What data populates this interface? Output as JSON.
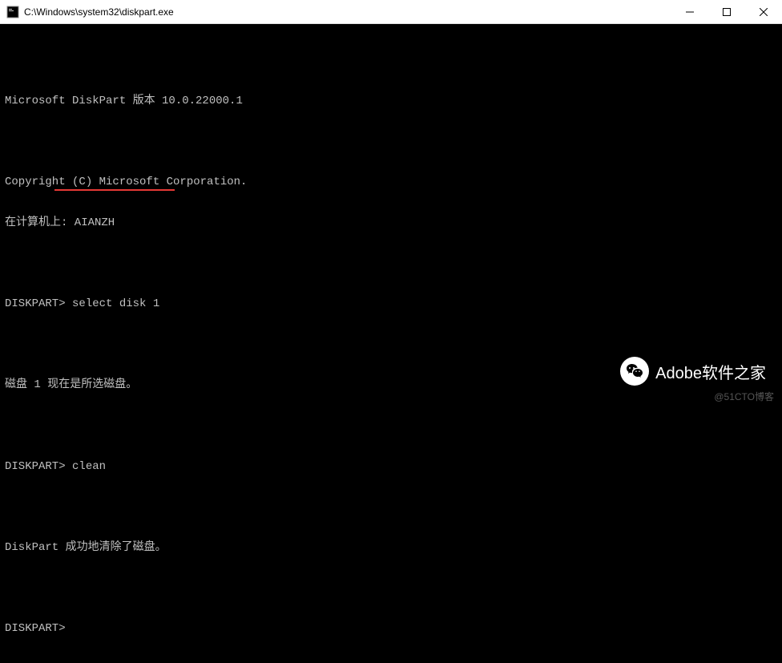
{
  "window": {
    "title": "C:\\Windows\\system32\\diskpart.exe"
  },
  "console": {
    "lines": [
      "",
      "Microsoft DiskPart 版本 10.0.22000.1",
      "",
      "Copyright (C) Microsoft Corporation.",
      "在计算机上: AIANZH",
      "",
      "DISKPART> select disk 1",
      "",
      "磁盘 1 现在是所选磁盘。",
      "",
      "DISKPART> clean",
      "",
      "DiskPart 成功地清除了磁盘。",
      "",
      "DISKPART>"
    ]
  },
  "badge": {
    "text": "Adobe软件之家"
  },
  "watermark": {
    "text": "@51CTO博客"
  }
}
